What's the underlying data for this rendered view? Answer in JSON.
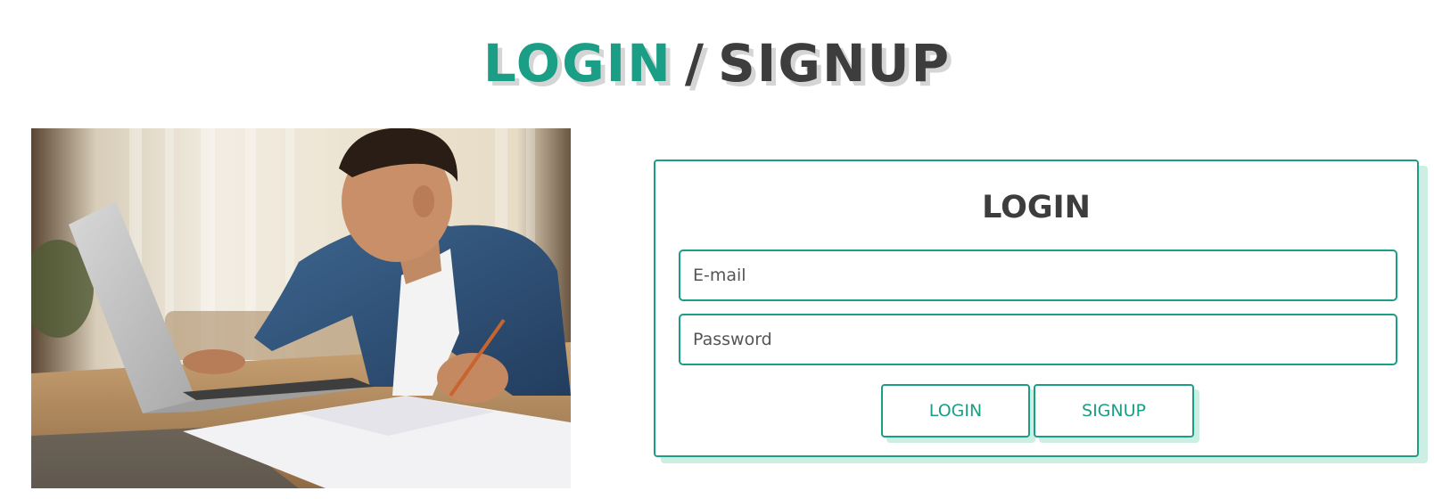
{
  "header": {
    "title_login": "LOGIN",
    "title_separator": "/",
    "title_signup": "SIGNUP"
  },
  "form": {
    "heading": "LOGIN",
    "email_placeholder": "E-mail",
    "email_value": "",
    "password_placeholder": "Password",
    "password_value": "",
    "login_button": "LOGIN",
    "signup_button": "SIGNUP"
  },
  "colors": {
    "accent": "#1a9e85",
    "accent_shadow": "#cdeee2",
    "dark_text": "#3d3d3d"
  }
}
